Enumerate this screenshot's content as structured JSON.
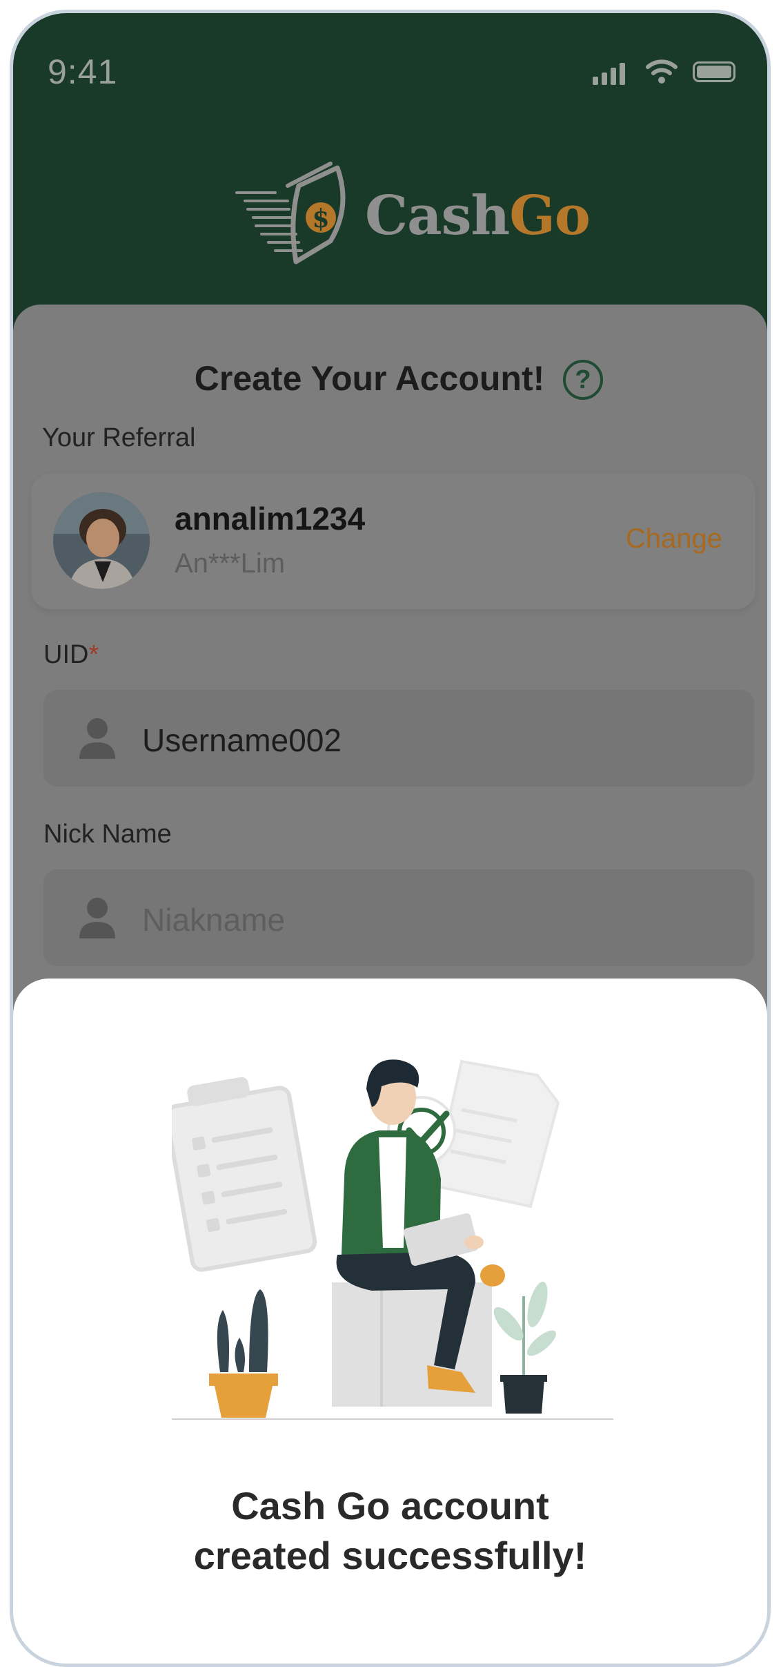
{
  "status_bar": {
    "time": "9:41"
  },
  "brand": {
    "name_part1": "Cash",
    "name_part2": "Go",
    "logo_badge": "$",
    "colors": {
      "header_green": "#1a3a29",
      "accent_orange": "#b5772a"
    }
  },
  "form": {
    "title": "Create Your Account!",
    "help_glyph": "?",
    "referral": {
      "label": "Your Referral",
      "username": "annalim1234",
      "masked_name": "An***Lim",
      "change_label": "Change"
    },
    "uid": {
      "label": "UID",
      "required_mark": "*",
      "value": "Username002"
    },
    "nickname": {
      "label": "Nick Name",
      "placeholder": "Niakname"
    }
  },
  "sheet": {
    "message": "Cash Go account created successfully!"
  },
  "icons": [
    "signal-icon",
    "wifi-icon",
    "battery-icon",
    "help-icon",
    "user-icon",
    "check-icon"
  ]
}
